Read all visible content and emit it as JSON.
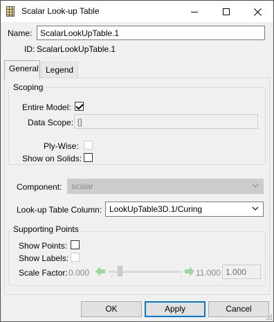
{
  "window": {
    "title": "Scalar Look-up Table",
    "title_icon": "table-icon",
    "min_icon": "minimize-icon",
    "max_icon": "maximize-icon",
    "close_icon": "close-icon"
  },
  "name": {
    "label": "Name:",
    "value": "ScalarLookUpTable.1"
  },
  "id": {
    "label": "ID:",
    "value": "ScalarLookUpTable.1"
  },
  "tabs": [
    {
      "label": "General",
      "active": true
    },
    {
      "label": "Legend",
      "active": false
    }
  ],
  "scoping": {
    "title": "Scoping",
    "entire_model": {
      "label": "Entire Model:",
      "checked": true
    },
    "data_scope": {
      "label": "Data Scope:",
      "value": "[]"
    },
    "ply_wise": {
      "label": "Ply-Wise:",
      "checked": false,
      "enabled": false
    },
    "show_on_solids": {
      "label": "Show on Solids:",
      "checked": false
    }
  },
  "component": {
    "label": "Component:",
    "value": "scalar",
    "enabled": false
  },
  "lookup_column": {
    "label": "Look-up Table Column:",
    "value": "LookUpTable3D.1/Curing"
  },
  "supporting_points": {
    "title": "Supporting Points",
    "show_points": {
      "label": "Show Points:",
      "checked": false
    },
    "show_labels": {
      "label": "Show Labels:",
      "checked": false,
      "enabled": false
    },
    "scale_factor": {
      "label": "Scale Factor:",
      "min": "0.000",
      "max": "11.000",
      "value": "1.000",
      "left_icon": "arrow-left-icon",
      "right_icon": "arrow-right-icon"
    }
  },
  "buttons": {
    "ok": "OK",
    "apply": "Apply",
    "cancel": "Cancel"
  },
  "colors": {
    "accent": "#0078d7",
    "arrow_green": "#9bd89b"
  }
}
